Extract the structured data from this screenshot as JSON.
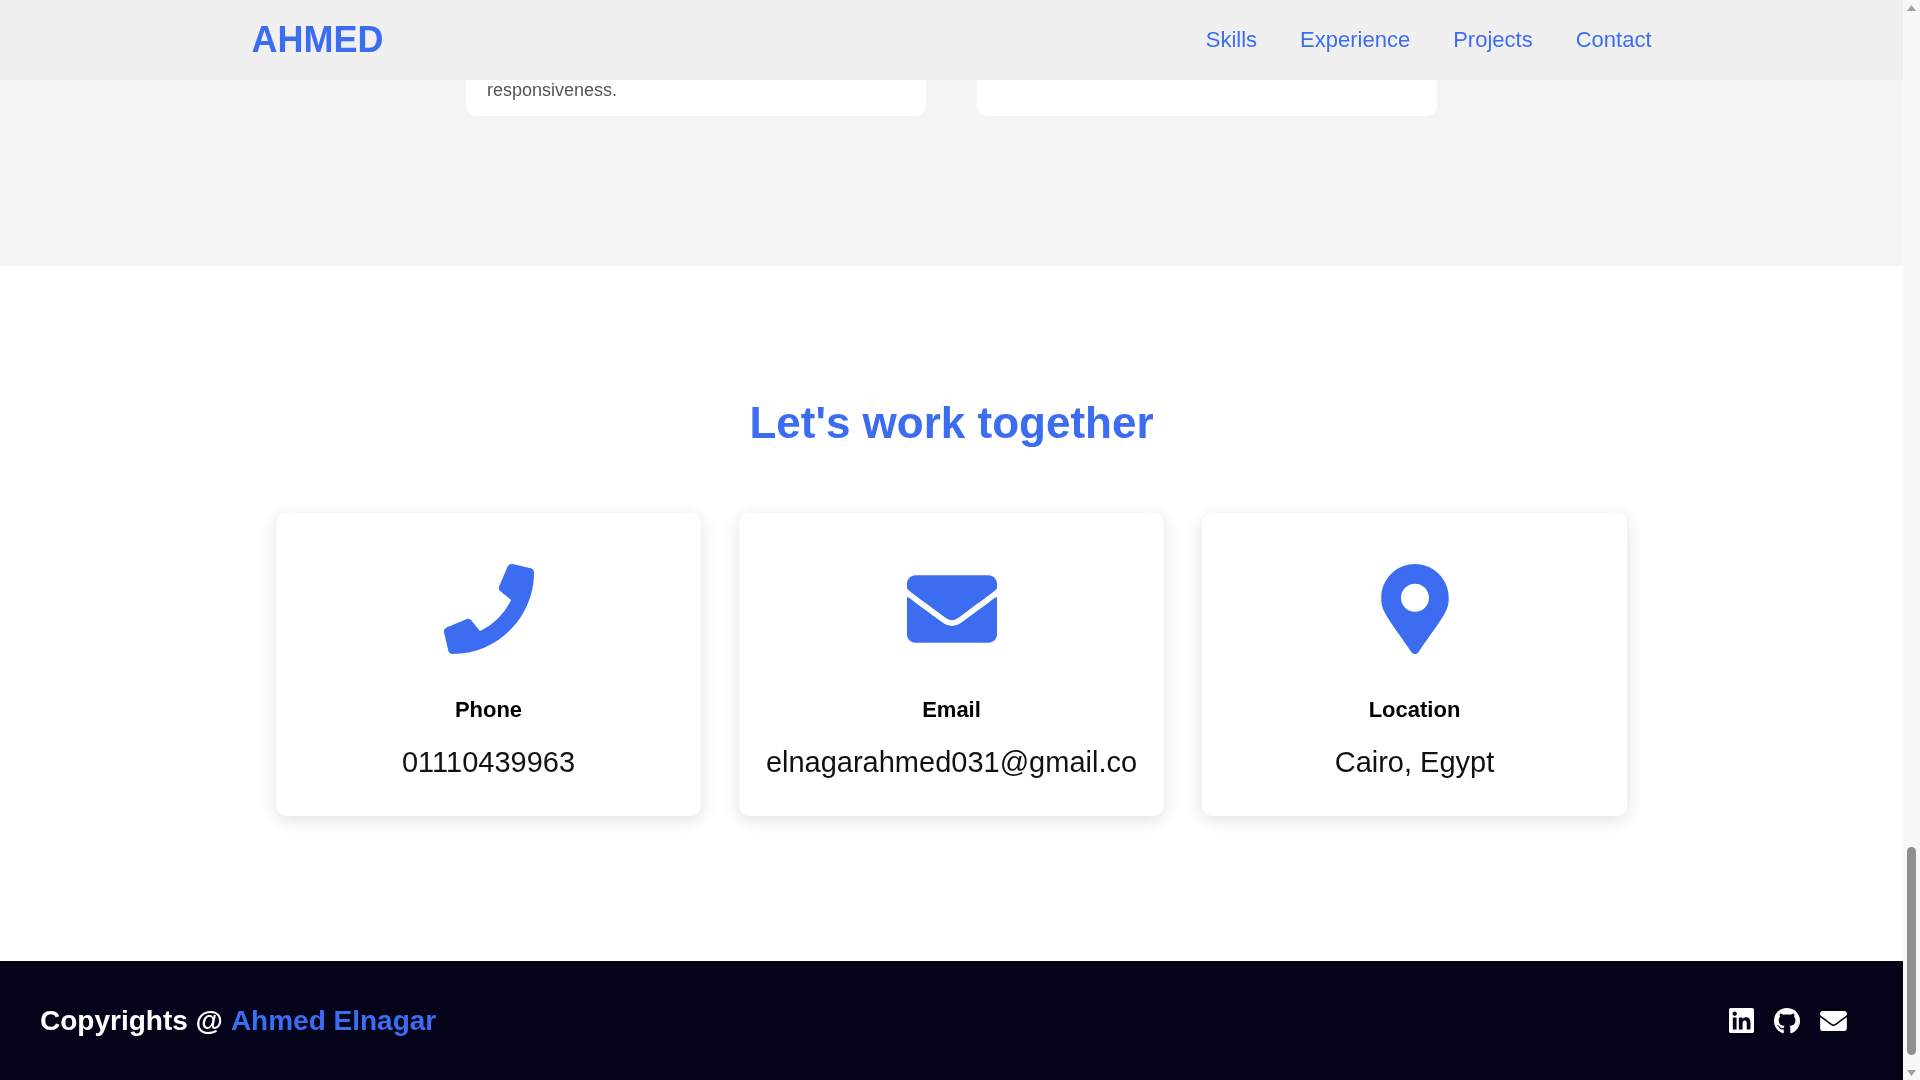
{
  "header": {
    "logo": "AHMED",
    "nav": [
      {
        "label": "Skills"
      },
      {
        "label": "Experience"
      },
      {
        "label": "Projects"
      },
      {
        "label": "Contact"
      }
    ]
  },
  "project_cards": [
    {
      "text": "responsiveness."
    }
  ],
  "contact": {
    "title": "Let's work together",
    "cards": [
      {
        "kind": "phone",
        "label": "Phone",
        "value": "01110439963"
      },
      {
        "kind": "email",
        "label": "Email",
        "value": "elnagarahmed031@gmail.co"
      },
      {
        "kind": "location",
        "label": "Location",
        "value": "Cairo, Egypt"
      }
    ]
  },
  "footer": {
    "copyright": "Copyrights @",
    "author": "Ahmed Elnagar",
    "social": [
      {
        "kind": "linkedin"
      },
      {
        "kind": "github"
      },
      {
        "kind": "email"
      }
    ]
  }
}
